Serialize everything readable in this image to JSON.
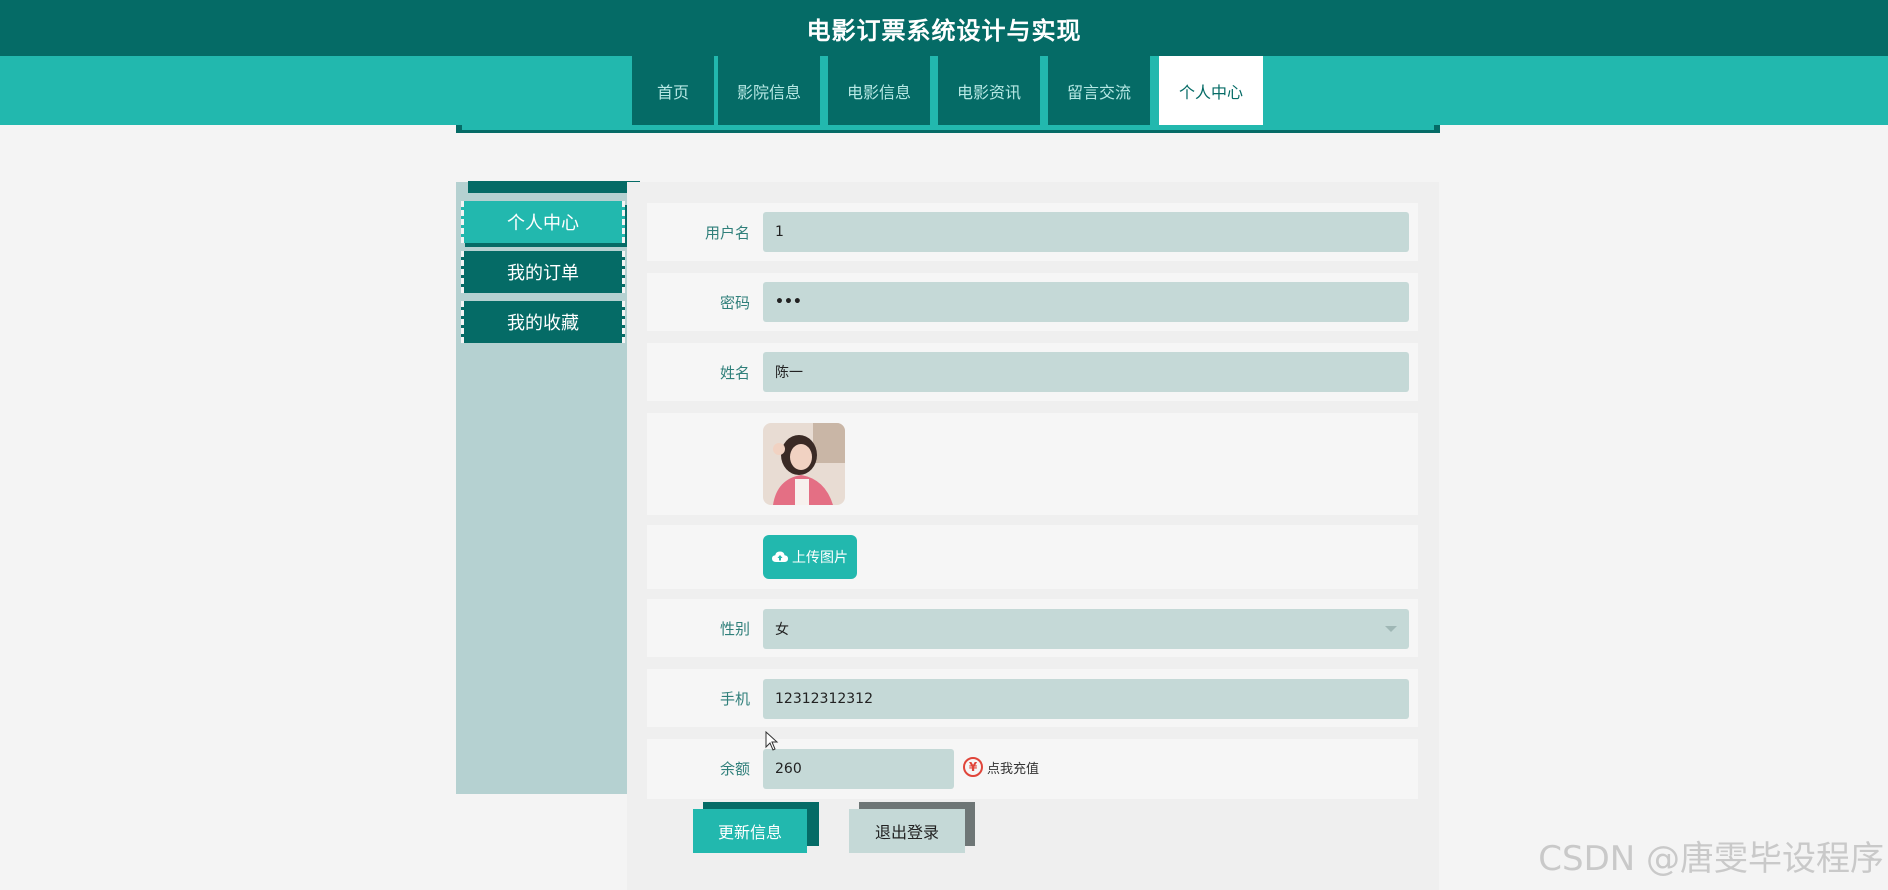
{
  "header": {
    "title": "电影订票系统设计与实现"
  },
  "nav": {
    "tabs": [
      {
        "label": "首页"
      },
      {
        "label": "影院信息"
      },
      {
        "label": "电影信息"
      },
      {
        "label": "电影资讯"
      },
      {
        "label": "留言交流"
      },
      {
        "label": "个人中心",
        "active": true
      }
    ]
  },
  "sidebar": {
    "items": [
      {
        "label": "个人中心",
        "active": true
      },
      {
        "label": "我的订单"
      },
      {
        "label": "我的收藏"
      }
    ]
  },
  "form": {
    "username": {
      "label": "用户名",
      "value": "1"
    },
    "password": {
      "label": "密码",
      "value": "•••"
    },
    "name": {
      "label": "姓名",
      "value": "陈一"
    },
    "upload": {
      "label": "上传图片"
    },
    "gender": {
      "label": "性别",
      "value": "女"
    },
    "phone": {
      "label": "手机",
      "value": "12312312312"
    },
    "balance": {
      "label": "余额",
      "value": "260"
    },
    "recharge": {
      "label": "点我充值"
    }
  },
  "actions": {
    "update_label": "更新信息",
    "logout_label": "退出登录"
  },
  "watermark": "CSDN @唐雯毕设程序",
  "colors": {
    "primary_dark": "#056b66",
    "primary": "#22b8ae",
    "input_bg": "#c5d9d7",
    "sidebar_bg": "#b5d1d1",
    "recharge_red": "#e0453a"
  }
}
